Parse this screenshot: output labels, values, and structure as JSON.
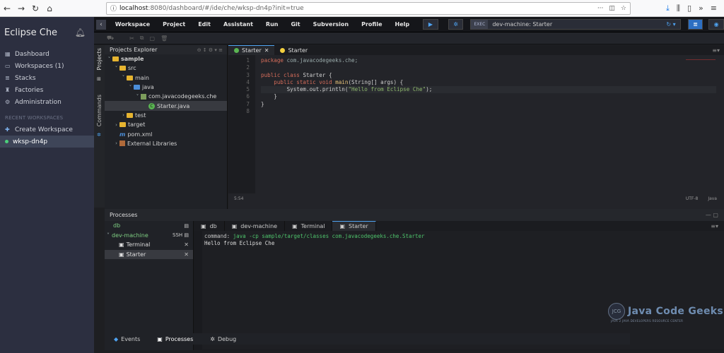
{
  "browser": {
    "url_host": "localhost",
    "url_path": ":8080/dashboard/#/ide/che/wksp-dn4p?init=true"
  },
  "dashboard": {
    "brand": "Eclipse Che",
    "nav": [
      "Dashboard",
      "Workspaces (1)",
      "Stacks",
      "Factories",
      "Administration"
    ],
    "recent_title": "RECENT WORKSPACES",
    "create_ws": "Create Workspace",
    "active_ws": "wksp-dn4p"
  },
  "menubar": {
    "items": [
      "Workspace",
      "Project",
      "Edit",
      "Assistant",
      "Run",
      "Git",
      "Subversion",
      "Profile",
      "Help"
    ],
    "exec_tag": "EXEC",
    "machine": "dev-machine: Starter"
  },
  "sidetabs": {
    "projects": "Projects",
    "commands": "Commands"
  },
  "explorer": {
    "title": "Projects Explorer",
    "tree": [
      "sample",
      "src",
      "main",
      "java",
      "com.javacodegeeks.che",
      "Starter.java",
      "test",
      "target",
      "pom.xml",
      "External Libraries"
    ]
  },
  "editor": {
    "tabs": [
      "Starter",
      "Starter"
    ],
    "gutter": [
      "1",
      "2",
      "3",
      "4",
      "5",
      "6",
      "7",
      "8"
    ],
    "pkg_kw": "package",
    "pkg_name": " com.javacodegeeks.che;",
    "cls_kw": "public class",
    "cls_name": " Starter {",
    "main_kw": "    public static void",
    "main_fn": " main",
    "main_args": "(String[] args) {",
    "print_obj": "        System.out.println(",
    "print_str": "\"Hello from Eclipse Che\"",
    "print_end": ");",
    "close1": "    }",
    "close2": "}",
    "status_pos": "5:54",
    "status_enc": "UTF-8",
    "status_lang": "Java"
  },
  "processes": {
    "title": "Processes",
    "items": [
      "db",
      "dev-machine",
      "Terminal",
      "Starter"
    ],
    "ssh": "SSH",
    "tabs": [
      "db",
      "dev-machine",
      "Terminal",
      "Starter"
    ],
    "cmd_label": "command:",
    "cmd": " java -cp sample/target/classes com.javacodegeeks.che.Starter",
    "output": "Hello from Eclipse Che"
  },
  "bottom": {
    "tabs": [
      "Events",
      "Processes",
      "Debug"
    ]
  },
  "watermark": {
    "title": "Java Code Geeks",
    "sub": "JAVA 2 JAVA DEVELOPERS RESOURCE CENTER",
    "logo": "JCG"
  }
}
